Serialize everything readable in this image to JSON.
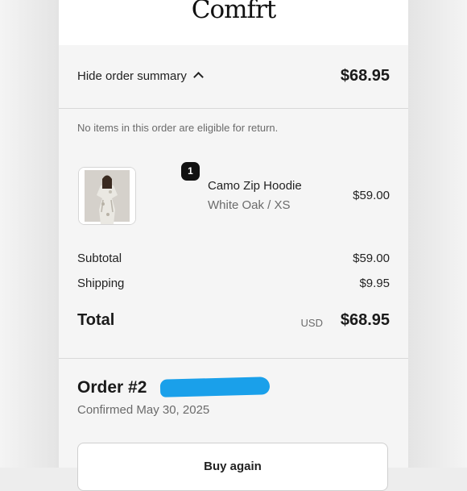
{
  "brand": {
    "logo_text": "Comfrt"
  },
  "summary": {
    "toggle_label": "Hide order summary",
    "total": "$68.95",
    "return_note": "No items in this order are eligible for return."
  },
  "line_item": {
    "quantity": "1",
    "name": "Camo Zip Hoodie",
    "variant": "White Oak / XS",
    "price": "$59.00"
  },
  "totals": {
    "subtotal_label": "Subtotal",
    "subtotal_value": "$59.00",
    "shipping_label": "Shipping",
    "shipping_value": "$9.95",
    "total_label": "Total",
    "currency": "USD",
    "total_value": "$68.95"
  },
  "order": {
    "title_prefix": "Order #2",
    "confirmed": "Confirmed May 30, 2025",
    "buy_again_label": "Buy again"
  },
  "colors": {
    "redaction": "#1aa0ea",
    "panel_bg": "#f5f5f5"
  }
}
